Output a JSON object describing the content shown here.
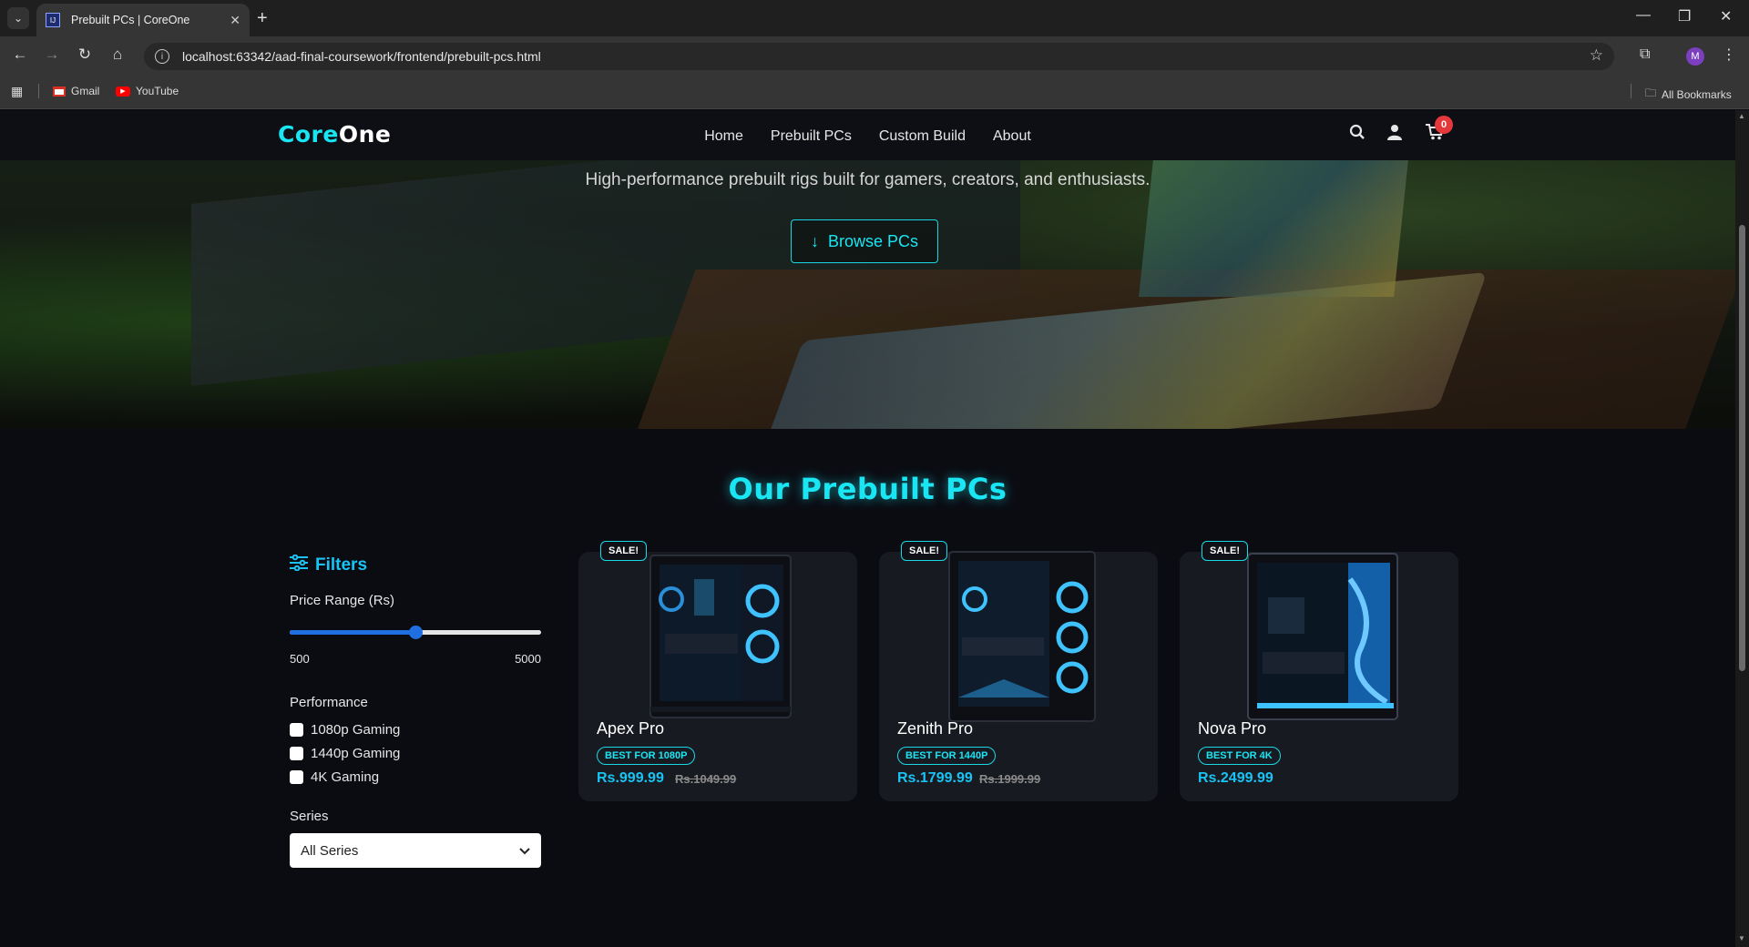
{
  "browser": {
    "tab_title": "Prebuilt PCs | CoreOne",
    "url": "localhost:63342/aad-final-coursework/frontend/prebuilt-pcs.html",
    "profile_initial": "M",
    "bookmarks": [
      {
        "label": "Gmail",
        "icon": "gmail-icon"
      },
      {
        "label": "YouTube",
        "icon": "youtube-icon"
      }
    ],
    "all_bookmarks": "All Bookmarks"
  },
  "site": {
    "logo": "CoreOne",
    "nav": [
      "Home",
      "Prebuilt PCs",
      "Custom Build",
      "About"
    ],
    "cart_count": "0"
  },
  "hero": {
    "subtitle": "High-performance prebuilt rigs built for gamers, creators, and enthusiasts.",
    "button": "Browse PCs"
  },
  "section_title": "Our Prebuilt PCs",
  "filters": {
    "title": "Filters",
    "price_label": "Price Range (Rs)",
    "price_min": "500",
    "price_max": "5000",
    "price_value_fraction": 0.5,
    "performance_label": "Performance",
    "performance_options": [
      "1080p Gaming",
      "1440p Gaming",
      "4K Gaming"
    ],
    "series_label": "Series",
    "series_selected": "All Series"
  },
  "products": [
    {
      "name": "Apex Pro",
      "sale": "SALE!",
      "badge": "BEST FOR 1080P",
      "price": "Rs.999.99",
      "old_price": "Rs.1049.99"
    },
    {
      "name": "Zenith Pro",
      "sale": "SALE!",
      "badge": "BEST FOR 1440P",
      "price": "Rs.1799.99",
      "old_price": "Rs.1999.99"
    },
    {
      "name": "Nova Pro",
      "sale": "SALE!",
      "badge": "BEST FOR 4K",
      "price": "Rs.2499.99",
      "old_price": ""
    }
  ],
  "colors": {
    "accent": "#19e5f3",
    "slider": "#1f6fe0",
    "badge_red": "#e5383b"
  }
}
